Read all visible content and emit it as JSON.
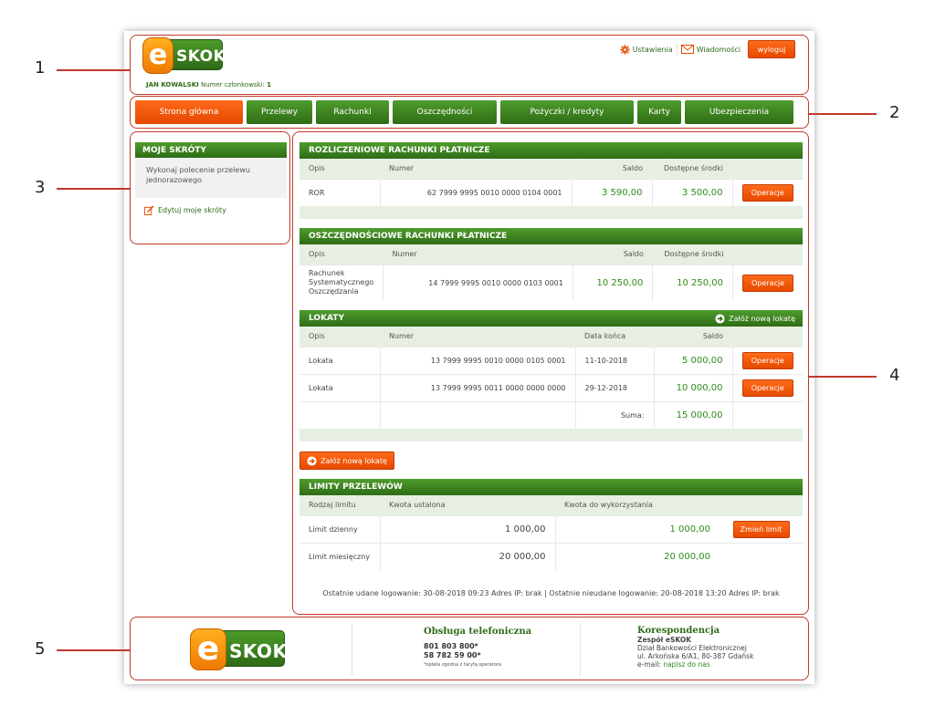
{
  "callouts": [
    "1",
    "2",
    "3",
    "4",
    "5"
  ],
  "header": {
    "logo_letter": "e",
    "logo_text": "SKOK",
    "user_name": "JAN KOWALSKI",
    "member_label": "Numer członkowski:",
    "member_number": "1",
    "settings_label": "Ustawienia",
    "messages_label": "Wiadomości",
    "logout_label": "wyloguj"
  },
  "nav": [
    {
      "label": "Strona główna",
      "width": 118,
      "active": true
    },
    {
      "label": "Przelewy",
      "width": 72
    },
    {
      "label": "Rachunki",
      "width": 80
    },
    {
      "label": "Oszczędności",
      "width": 114
    },
    {
      "label": "Pożyczki / kredyty",
      "width": 146
    },
    {
      "label": "Karty",
      "width": 48
    },
    {
      "label": "Ubezpieczenia",
      "width": 119
    }
  ],
  "sidebar": {
    "title": "MOJE SKRÓTY",
    "item": "Wykonaj polecenie przelewu jednorazowego",
    "edit_label": "Edytuj moje skróty"
  },
  "settlement": {
    "title": "ROZLICZENIOWE RACHUNKI PŁATNICZE",
    "headers": [
      "Opis",
      "Numer",
      "Saldo",
      "Dostępne środki"
    ],
    "rows": [
      {
        "opis": "ROR",
        "numer": "62 7999 9995 0010 0000 0104 0001",
        "saldo": "3 590,00",
        "dostepne": "3 500,00",
        "action": "Operacje"
      }
    ]
  },
  "savings": {
    "title": "OSZCZĘDNOŚCIOWE RACHUNKI PŁATNICZE",
    "headers": [
      "Opis",
      "Numer",
      "Saldo",
      "Dostępne środki"
    ],
    "rows": [
      {
        "opis": "Rachunek Systematycznego Oszczędzania",
        "numer": "14 7999 9995 0010 0000 0103 0001",
        "saldo": "10 250,00",
        "dostepne": "10 250,00",
        "action": "Operacje"
      }
    ]
  },
  "deposits": {
    "title": "LOKATY",
    "new_label": "Załóż nową lokatę",
    "headers": [
      "Opis",
      "Numer",
      "Data końca",
      "Saldo"
    ],
    "rows": [
      {
        "opis": "Lokata",
        "numer": "13 7999 9995 0010 0000 0105 0001",
        "data": "11-10-2018",
        "saldo": "5 000,00",
        "action": "Operacje"
      },
      {
        "opis": "Lokata",
        "numer": "13 7999 9995 0011 0000 0000 0000",
        "data": "29-12-2018",
        "saldo": "10 000,00",
        "action": "Operacje"
      }
    ],
    "sum_label": "Suma:",
    "sum_value": "15 000,00",
    "add_button": "Załóż nową lokatę"
  },
  "limits": {
    "title": "LIMITY PRZELEWÓW",
    "headers": [
      "Rodzaj limitu",
      "Kwota ustalona",
      "Kwota do wykorzystania"
    ],
    "rows": [
      {
        "rodzaj": "Limit dzienny",
        "ustalona": "1 000,00",
        "dostepna": "1 000,00",
        "action": "Zmień limit"
      },
      {
        "rodzaj": "Limit miesięczny",
        "ustalona": "20 000,00",
        "dostepna": "20 000,00"
      }
    ]
  },
  "last_login": "Ostatnie udane logowanie: 30-08-2018 09:23 Adres IP: brak  |  Ostatnie nieudane logowanie: 20-08-2018 13:20 Adres IP: brak",
  "footer": {
    "phone_title": "Obsługa telefoniczna",
    "phone1": "801 803 800*",
    "phone2": "58 782 59 00*",
    "phone_note": "*opłata zgodna z taryfą operatora",
    "mail_title": "Korespondencja",
    "mail_team": "Zespół eSKOK",
    "mail_dept": "Dział Bankowości Elektronicznej",
    "mail_address": "ul. Arkońska 6/A1, 80-387 Gdańsk",
    "mail_email_label": "e-mail:",
    "mail_email_link": "napisz do nas"
  },
  "colors": {
    "green": "#2e6c16",
    "orange": "#e64a00",
    "annotation": "#c0392b"
  }
}
